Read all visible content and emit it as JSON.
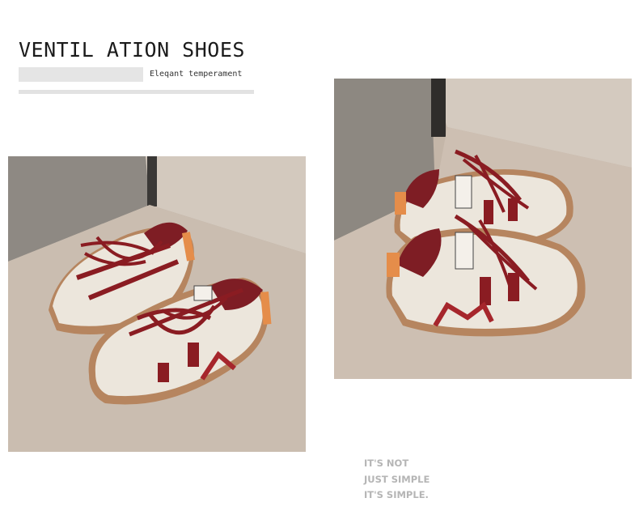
{
  "header": {
    "title": "VENTIL ATION SHOES",
    "subtitle": "Eleqant temperament"
  },
  "slogan": {
    "line1": "IT'S NOT",
    "line2": "JUST SIMPLE",
    "line3": "IT'S SIMPLE."
  },
  "colors": {
    "background": "#ffffff",
    "title": "#1b1b1b",
    "slogan": "#b5b5b5",
    "accent_burgundy": "#8a1c22",
    "sole": "#b8825a",
    "photo_backdrop": "#c9bcae"
  }
}
